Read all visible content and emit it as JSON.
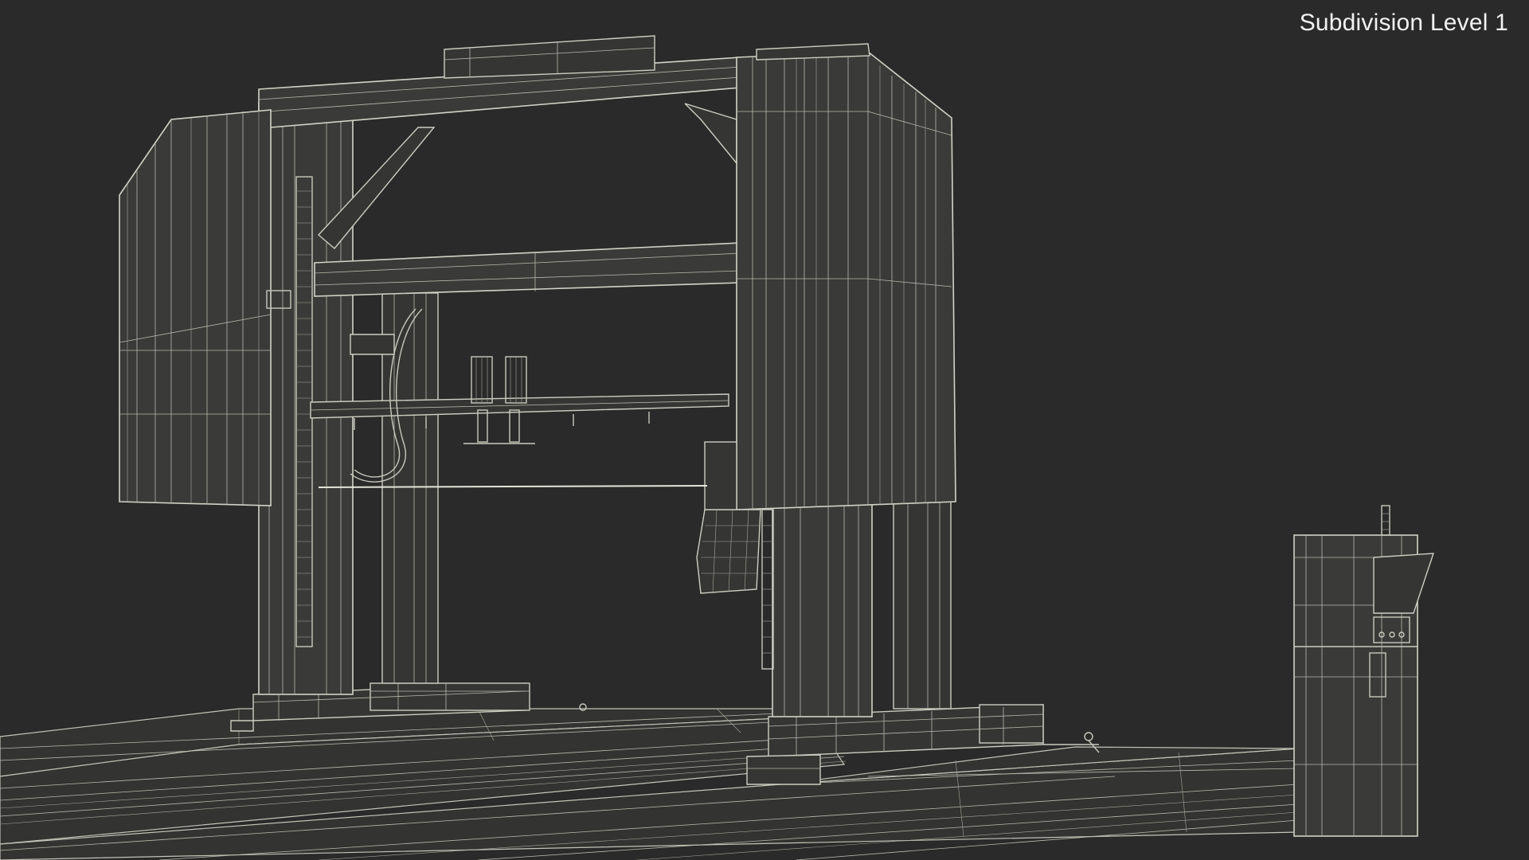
{
  "viewport": {
    "caption": "Subdivision Level 1",
    "background": "#2a2a2a",
    "wire_color": "#c9c9bf"
  }
}
